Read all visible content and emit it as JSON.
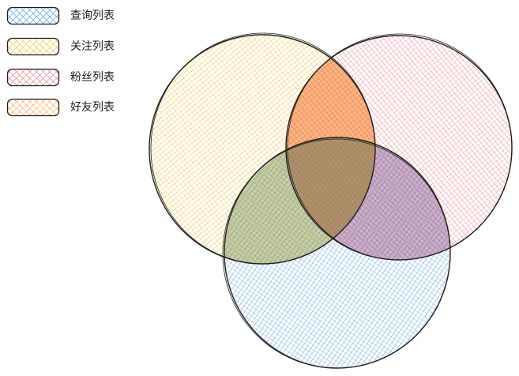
{
  "legend": {
    "items": [
      {
        "key": "query",
        "label": "查询列表",
        "color": "#3d8fe0"
      },
      {
        "key": "following",
        "label": "关注列表",
        "color": "#f5b820"
      },
      {
        "key": "followers",
        "label": "粉丝列表",
        "color": "#ee6c72"
      },
      {
        "key": "friends",
        "label": "好友列表",
        "color": "#f5a04a"
      }
    ]
  },
  "venn": {
    "sets": [
      {
        "key": "following",
        "color": "#f5b820"
      },
      {
        "key": "followers",
        "color": "#ee6c72"
      },
      {
        "key": "query",
        "color": "#3d8fe0"
      }
    ],
    "overlap_color": "#f57a2e",
    "stroke_color": "#1e1e1e"
  }
}
